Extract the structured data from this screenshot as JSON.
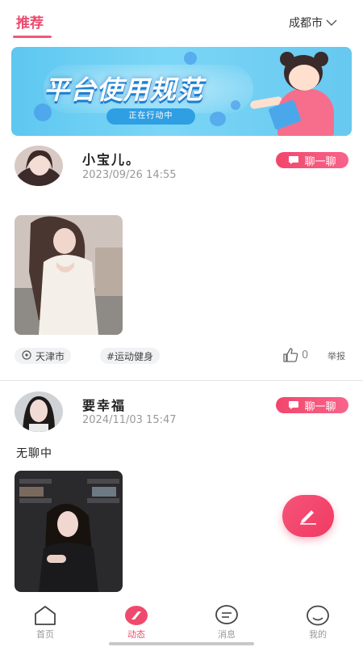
{
  "header": {
    "tab_label": "推荐",
    "city_label": "成都市"
  },
  "banner": {
    "title": "平台使用规范",
    "pill_text": "正在行动中"
  },
  "posts": [
    {
      "username": "小宝儿。",
      "time": "2023/09/26 14:55",
      "chat_label": "聊一聊",
      "text": "",
      "location_tag": "天津市",
      "topic_tag": "#运动健身",
      "like_count": "0",
      "report_label": "举报"
    },
    {
      "username": "要幸福",
      "time": "2024/11/03 15:47",
      "chat_label": "聊一聊",
      "text": "无聊中"
    }
  ],
  "nav": {
    "items": [
      {
        "label": "首页"
      },
      {
        "label": "动态"
      },
      {
        "label": "消息"
      },
      {
        "label": "我的"
      }
    ],
    "active_index": 1
  },
  "colors": {
    "accent": "#ef4a6e",
    "banner_bg": "#6fd0f4"
  }
}
